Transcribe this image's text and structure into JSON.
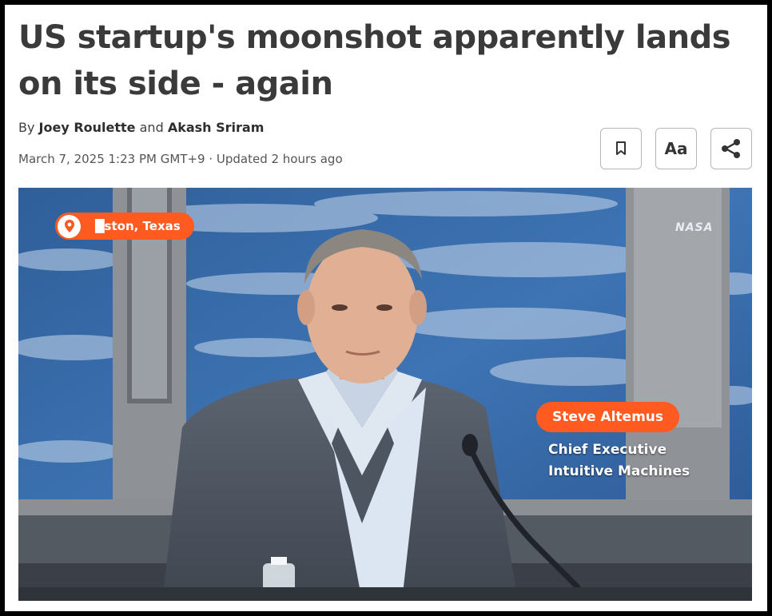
{
  "article": {
    "headline": "US startup's moonshot apparently lands on its side - again",
    "byline_prefix": "By",
    "author_1": "Joey Roulette",
    "byline_and": "and",
    "author_2": "Akash Sriram",
    "dateline": "March 7, 2025 1:23 PM GMT+9 · Updated 2 hours ago"
  },
  "toolbar": {
    "bookmark_icon": "bookmark-icon",
    "text_size_label": "Aa",
    "share_icon": "share-icon"
  },
  "video": {
    "location": "█ston, Texas",
    "location_icon": "location-pin-icon",
    "logo_text": "NASA",
    "speaker_name": "Steve Altemus",
    "speaker_title": "Chief Executive",
    "speaker_org": "Intuitive Machines"
  },
  "colors": {
    "accent": "#ff5a1f",
    "headline": "#3a3a3a"
  }
}
